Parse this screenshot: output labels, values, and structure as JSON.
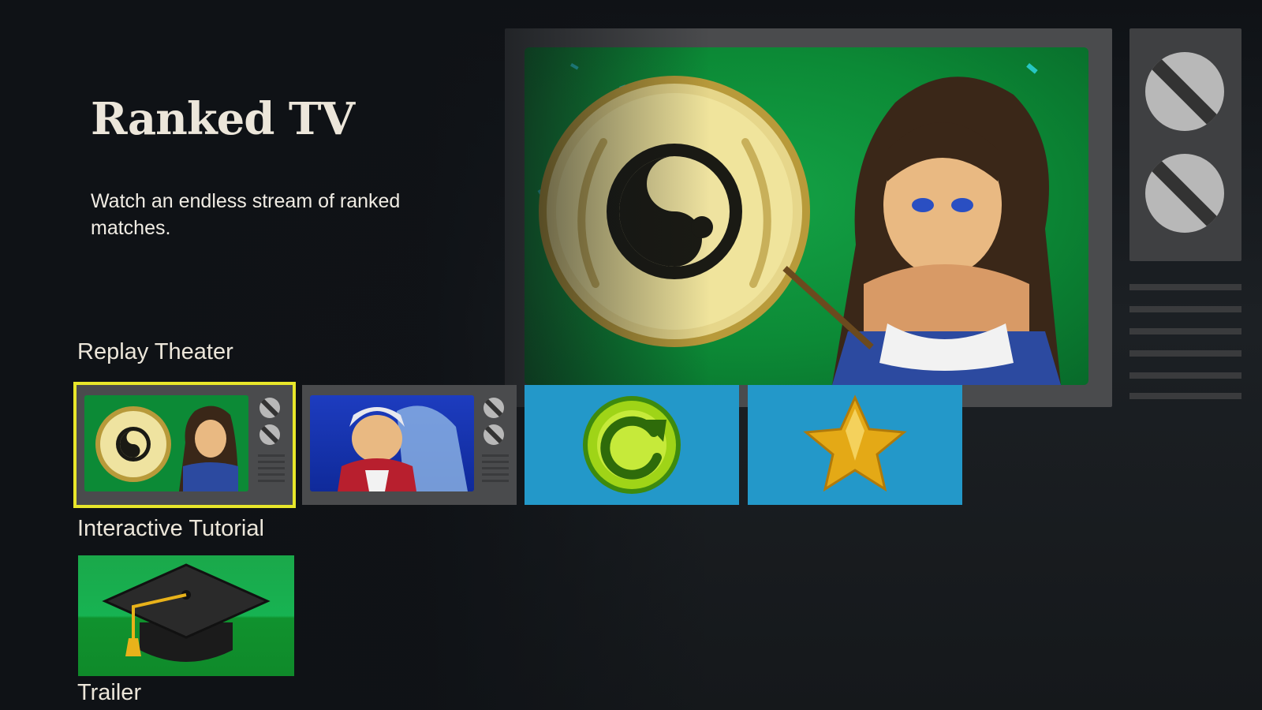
{
  "page": {
    "title": "Ranked TV",
    "description": "Watch an endless stream of ranked matches."
  },
  "sections": {
    "replay_theater": "Replay Theater",
    "interactive_tutorial": "Interactive Tutorial",
    "trailer": "Trailer"
  },
  "replay_tiles": [
    {
      "name": "ranked-tv",
      "selected": true
    },
    {
      "name": "replay-dragon-character"
    },
    {
      "name": "refresh",
      "icon": "refresh-icon"
    },
    {
      "name": "favorites",
      "icon": "star-icon"
    }
  ],
  "colors": {
    "selection": "#e8e62a",
    "tile_blue": "#2398c9",
    "hero_green": "#0c8a36"
  }
}
